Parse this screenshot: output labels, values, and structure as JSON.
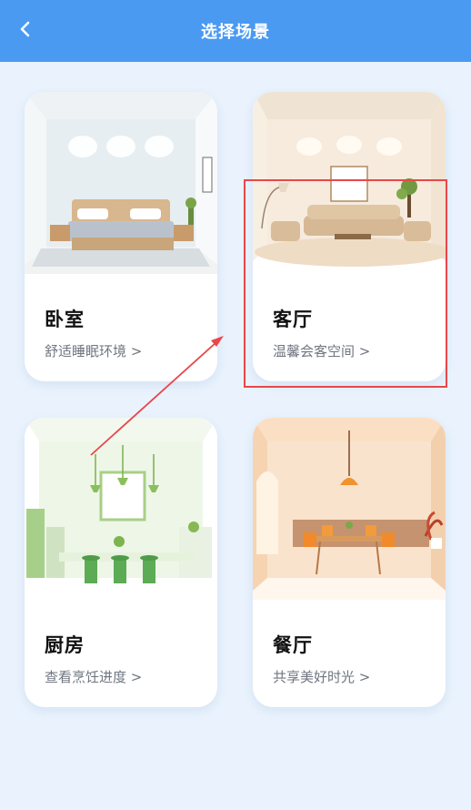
{
  "header": {
    "title": "选择场景",
    "back_icon": "chevron-left-icon"
  },
  "scenes": [
    {
      "name": "卧室",
      "desc": "舒适睡眠环境 >"
    },
    {
      "name": "客厅",
      "desc": "温馨会客空间 >"
    },
    {
      "name": "厨房",
      "desc": "查看烹饪进度 >"
    },
    {
      "name": "餐厅",
      "desc": "共享美好时光 >"
    }
  ],
  "colors": {
    "header_bg": "#4a9af2",
    "page_bg": "#eaf3fd",
    "annotation": "#e8474b"
  }
}
